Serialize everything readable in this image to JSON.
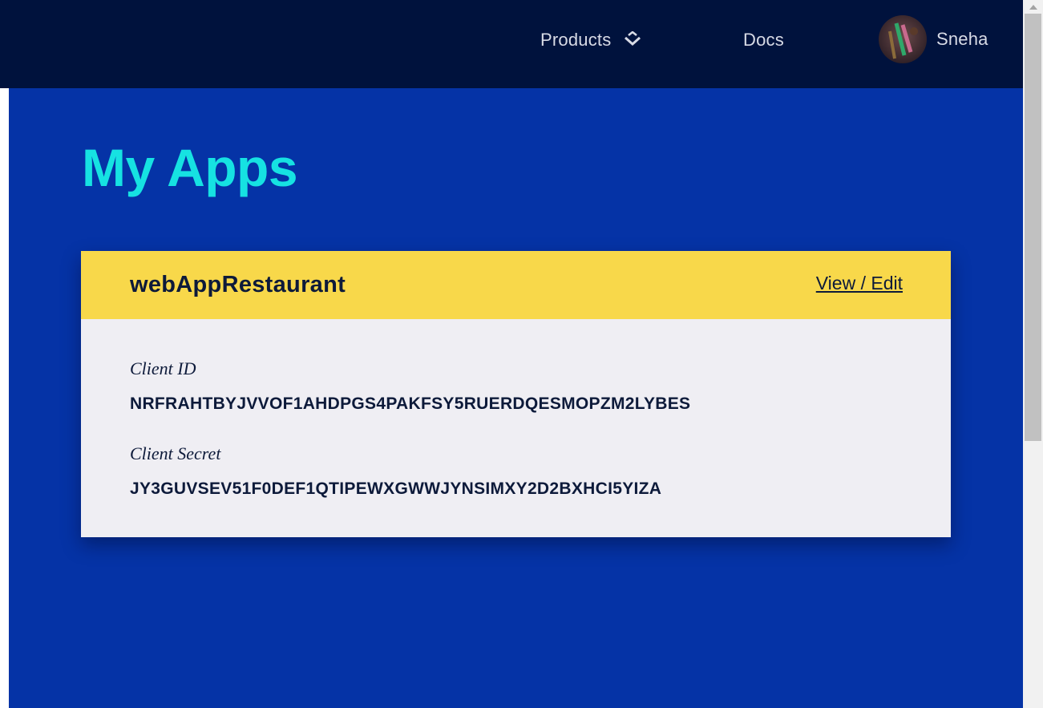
{
  "nav": {
    "products_label": "Products",
    "docs_label": "Docs",
    "user_name": "Sneha"
  },
  "page": {
    "title": "My Apps"
  },
  "app_card": {
    "name": "webAppRestaurant",
    "view_edit_label": "View / Edit",
    "client_id_label": "Client ID",
    "client_id_value": "NRFRAHTBYJVVOF1AHDPGS4PAKFSY5RUERDQESMOPZM2LYBES",
    "client_secret_label": "Client Secret",
    "client_secret_value": "JY3GUVSEV51F0DEF1QTIPEWXGWWJYNSIMXY2D2BXHCI5YIZA"
  },
  "colors": {
    "nav_bg": "#00123d",
    "main_bg": "#0533a6",
    "title": "#16e2e2",
    "card_header": "#f8d84a",
    "card_body": "#efeef3"
  },
  "icons": {
    "products_dropdown": "chevron-down-icon",
    "avatar": "avatar-photo"
  }
}
